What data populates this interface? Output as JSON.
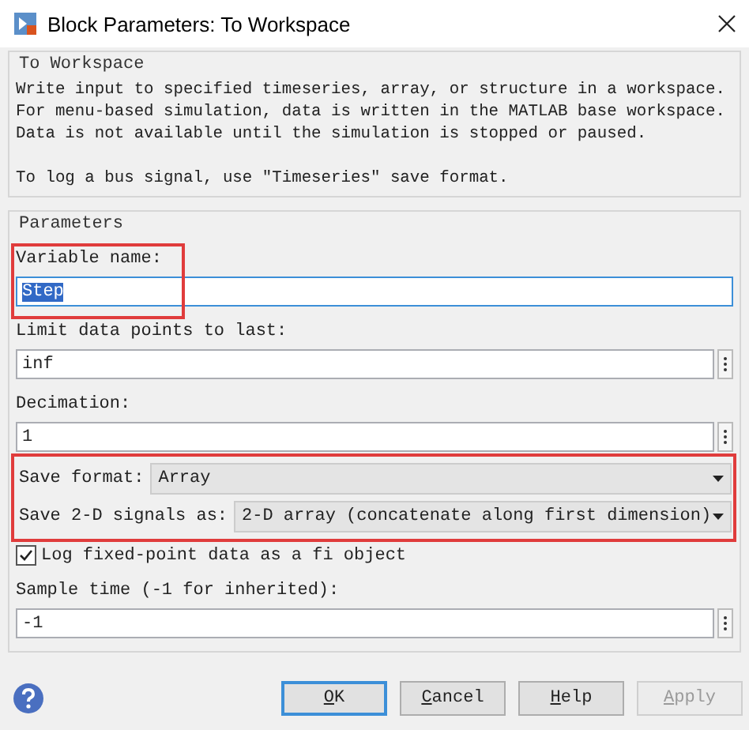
{
  "window": {
    "title": "Block Parameters: To Workspace"
  },
  "description": {
    "legend": "To Workspace",
    "paragraphs": [
      [
        "Write input to specified timeseries, array, or structure in a workspace.",
        "For menu-based simulation, data is written in the MATLAB base workspace.",
        "Data is not available until the simulation is stopped or paused."
      ],
      [
        "To log a bus signal, use \"Timeseries\" save format."
      ]
    ]
  },
  "parameters": {
    "legend": "Parameters",
    "items": [
      {
        "kind": "field",
        "label": "Variable name:",
        "value": "Step",
        "focused": true,
        "text_selected": true,
        "has_menu": false
      },
      {
        "kind": "field",
        "label": "Limit data points to last:",
        "value": "inf",
        "focused": false,
        "text_selected": false,
        "has_menu": true
      },
      {
        "kind": "field",
        "label": "Decimation:",
        "value": "1",
        "focused": false,
        "text_selected": false,
        "has_menu": true
      },
      {
        "kind": "dropdown",
        "label": "Save format:",
        "value": "Array"
      },
      {
        "kind": "dropdown",
        "label": "Save 2-D signals as:",
        "value": "2-D array (concatenate along first dimension)"
      },
      {
        "kind": "checkbox",
        "label": "Log fixed-point data as a fi object",
        "checked": true
      },
      {
        "kind": "field",
        "label": "Sample time (-1 for inherited):",
        "value": "-1",
        "focused": false,
        "text_selected": false,
        "has_menu": true
      }
    ]
  },
  "buttons": [
    {
      "label": "OK",
      "default": true,
      "disabled": false
    },
    {
      "label": "Cancel",
      "default": false,
      "disabled": false
    },
    {
      "label": "Help",
      "default": false,
      "disabled": false
    },
    {
      "label": "Apply",
      "default": false,
      "disabled": true
    }
  ]
}
